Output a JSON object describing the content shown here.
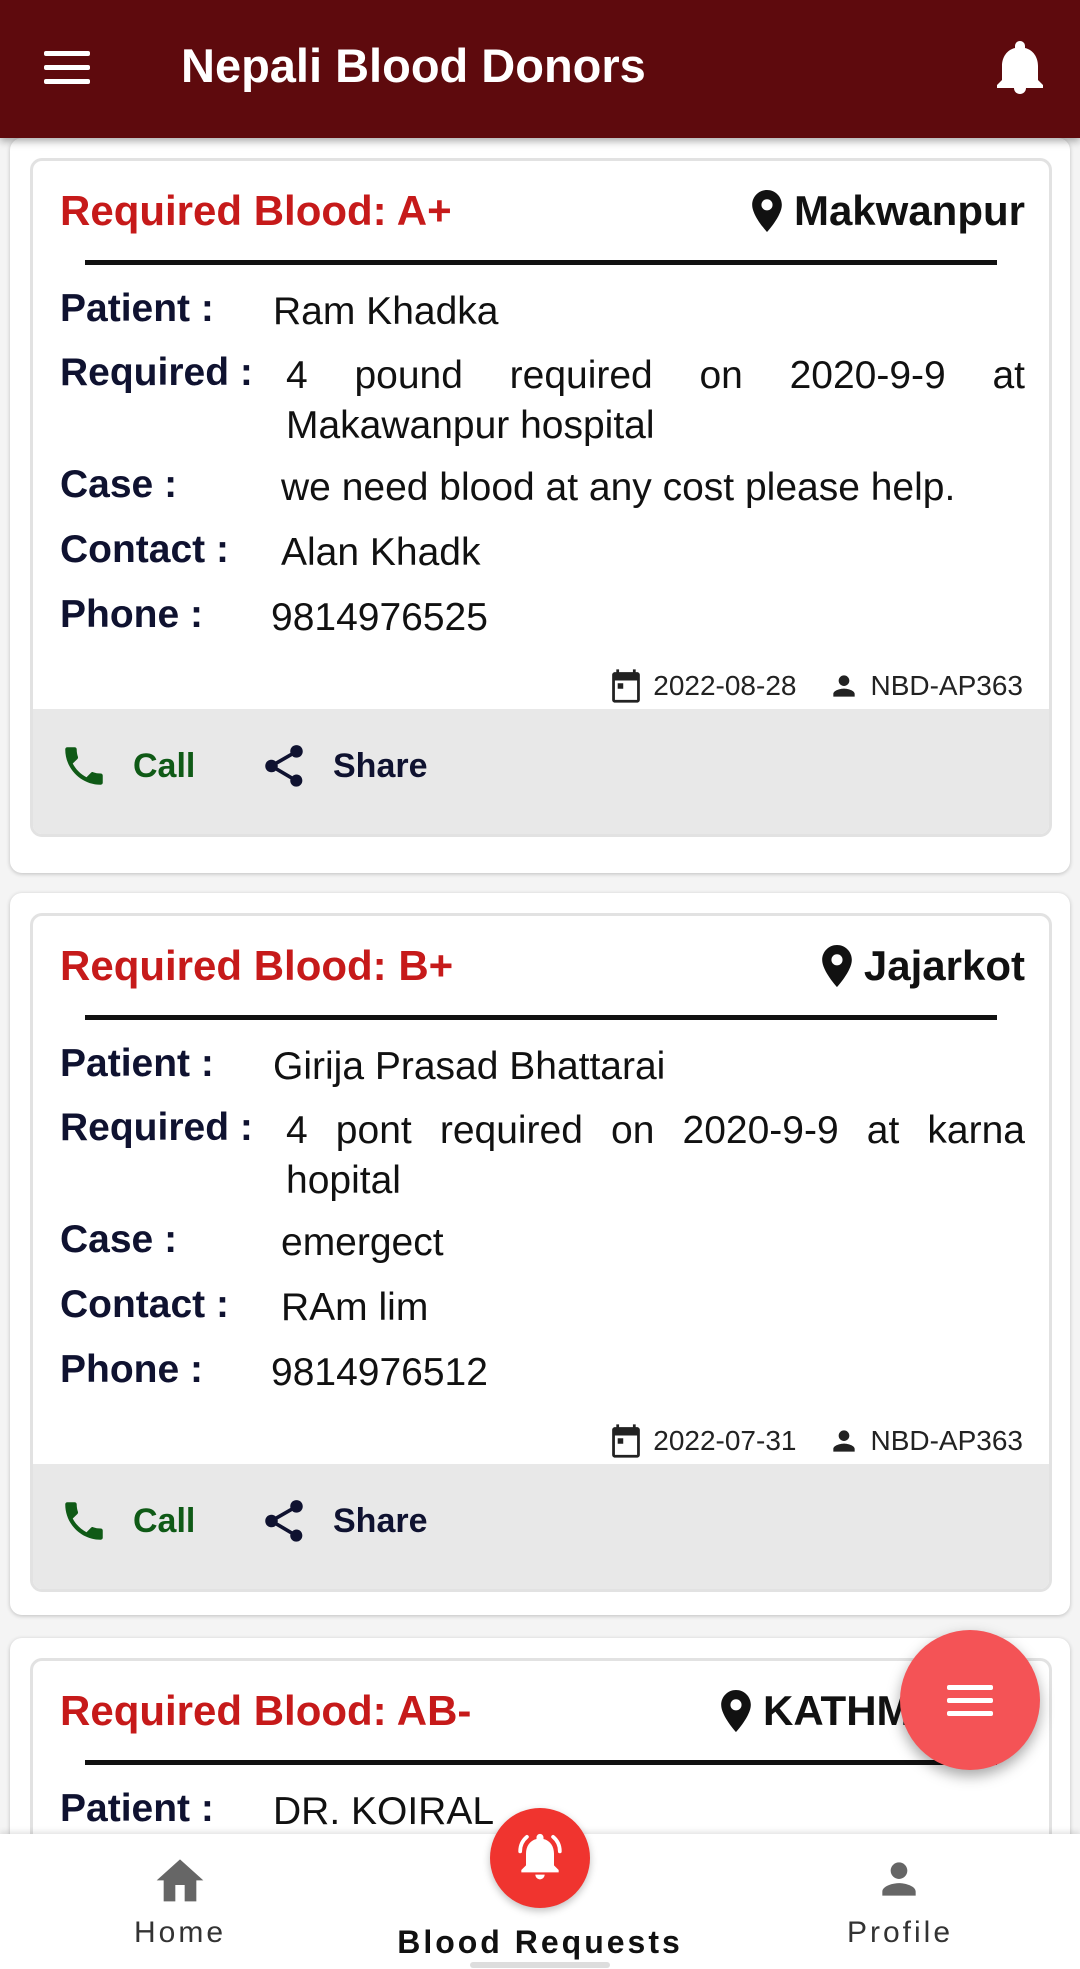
{
  "app": {
    "title": "Nepali Blood Donors"
  },
  "cards": [
    {
      "blood_label": "Required Blood: A+",
      "location": "Makwanpur",
      "patient_label": "Patient :",
      "patient": "Ram Khadka",
      "required_label": "Required :",
      "required": "4 pound required on 2020-9-9 at Makawanpur hospital",
      "case_label": "Case :",
      "case": "we need blood at any cost please help.",
      "contact_label": "Contact :",
      "contact": "Alan Khadk",
      "phone_label": "Phone :",
      "phone": "9814976525",
      "date": "2022-08-28",
      "user": "NBD-AP363",
      "call_label": "Call",
      "share_label": "Share"
    },
    {
      "blood_label": "Required Blood: B+",
      "location": "Jajarkot",
      "patient_label": "Patient :",
      "patient": "Girija Prasad Bhattarai",
      "required_label": "Required :",
      "required": "4 pont required on 2020-9-9 at karna hopital",
      "case_label": "Case :",
      "case": "emergect",
      "contact_label": "Contact :",
      "contact": "RAm lim",
      "phone_label": "Phone :",
      "phone": "9814976512",
      "date": "2022-07-31",
      "user": "NBD-AP363",
      "call_label": "Call",
      "share_label": "Share"
    },
    {
      "blood_label": "Required Blood: AB-",
      "location": "KATHM",
      "patient_label": "Patient :",
      "patient": "DR. KOIRAL"
    }
  ],
  "bottom_nav": {
    "home": "Home",
    "blood_requests": "Blood Requests",
    "profile": "Profile"
  },
  "colors": {
    "appbar": "#5e0a0d",
    "blood_red": "#c61a1a",
    "call_green": "#0f5a16",
    "fab": "#f45356",
    "center_button": "#f0342f"
  }
}
